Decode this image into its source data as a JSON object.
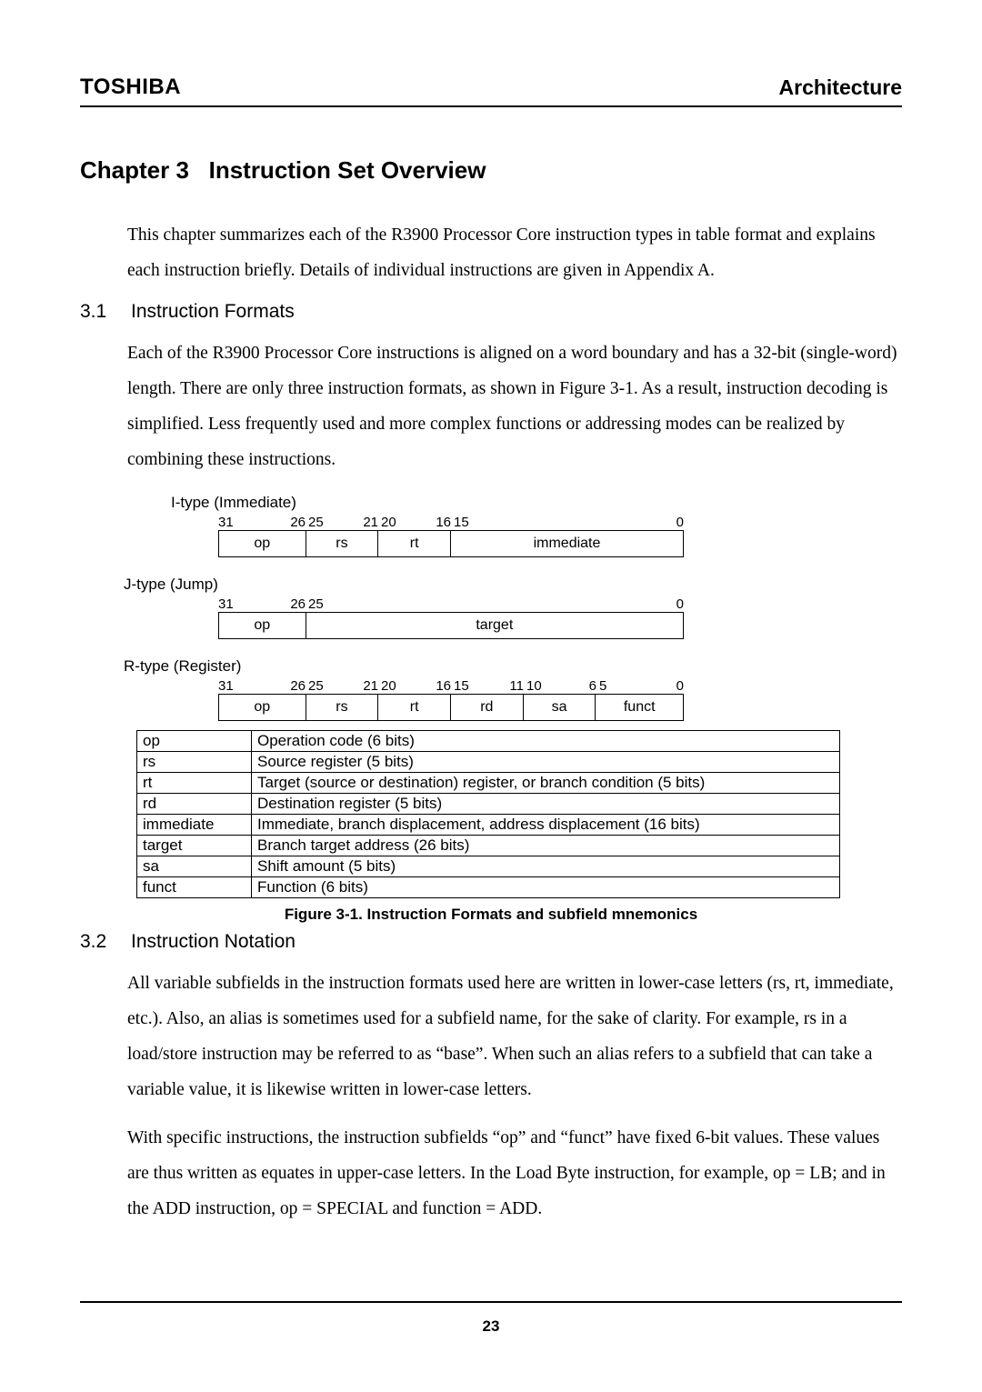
{
  "header": {
    "brand": "TOSHIBA",
    "section": "Architecture"
  },
  "chapter": {
    "label": "Chapter 3",
    "title": "Instruction Set Overview"
  },
  "intro": "This chapter summarizes each of the R3900 Processor Core instruction types in table format and explains each instruction briefly.   Details of individual instructions are given in Appendix A.",
  "sec31": {
    "num": "3.1",
    "title": "Instruction Formats"
  },
  "p31": "Each of the R3900 Processor Core instructions is aligned on a word boundary and has a 32-bit (single-word) length.   There are only three instruction formats, as shown in Figure 3-1.   As a result, instruction decoding is simplified. Less frequently used and more complex functions or addressing modes can be realized by combining these instructions.",
  "formats": {
    "i": {
      "label": "I-type (Immediate)",
      "bits": {
        "b31": "31",
        "b26": "26",
        "b25": "25",
        "b21": "21",
        "b20": "20",
        "b16": "16",
        "b15": "15",
        "b0": "0"
      },
      "fields": {
        "op": "op",
        "rs": "rs",
        "rt": "rt",
        "imm": "immediate"
      }
    },
    "j": {
      "label": "J-type (Jump)",
      "bits": {
        "b31": "31",
        "b26": "26",
        "b25": "25",
        "b0": "0"
      },
      "fields": {
        "op": "op",
        "target": "target"
      }
    },
    "r": {
      "label": "R-type (Register)",
      "bits": {
        "b31": "31",
        "b26": "26",
        "b25": "25",
        "b21": "21",
        "b20": "20",
        "b16": "16",
        "b15": "15",
        "b11": "11",
        "b10": "10",
        "b6": "6",
        "b5": "5",
        "b0": "0"
      },
      "fields": {
        "op": "op",
        "rs": "rs",
        "rt": "rt",
        "rd": "rd",
        "sa": "sa",
        "funct": "funct"
      }
    }
  },
  "defs": [
    {
      "k": "op",
      "v": "Operation code (6 bits)"
    },
    {
      "k": "rs",
      "v": "Source register (5 bits)"
    },
    {
      "k": "rt",
      "v": "Target (source or destination) register, or branch condition (5 bits)"
    },
    {
      "k": "rd",
      "v": "Destination register (5 bits)"
    },
    {
      "k": "immediate",
      "v": "Immediate, branch displacement, address displacement (16 bits)"
    },
    {
      "k": "target",
      "v": "Branch target address (26 bits)"
    },
    {
      "k": "sa",
      "v": "Shift amount (5 bits)"
    },
    {
      "k": "funct",
      "v": "Function (6 bits)"
    }
  ],
  "figcap": "Figure 3-1.   Instruction Formats and subfield mnemonics",
  "sec32": {
    "num": "3.2",
    "title": "Instruction Notation"
  },
  "p32a": "All variable subfields in the instruction formats used here are written in lower-case letters (rs, rt, immediate, etc.).   Also, an alias is sometimes used for a subfield name, for the sake of clarity.   For example, rs in a load/store instruction may be referred to as “base”.   When such an alias refers to a subfield that can take a variable value, it is likewise written in lower-case letters.",
  "p32b": "With specific instructions, the instruction subfields “op” and “funct” have fixed 6-bit values.   These values are thus written as equates in upper-case letters.   In the Load Byte instruction, for example, op = LB; and in the ADD instruction, op = SPECIAL and function = ADD.",
  "pagenum": "23"
}
